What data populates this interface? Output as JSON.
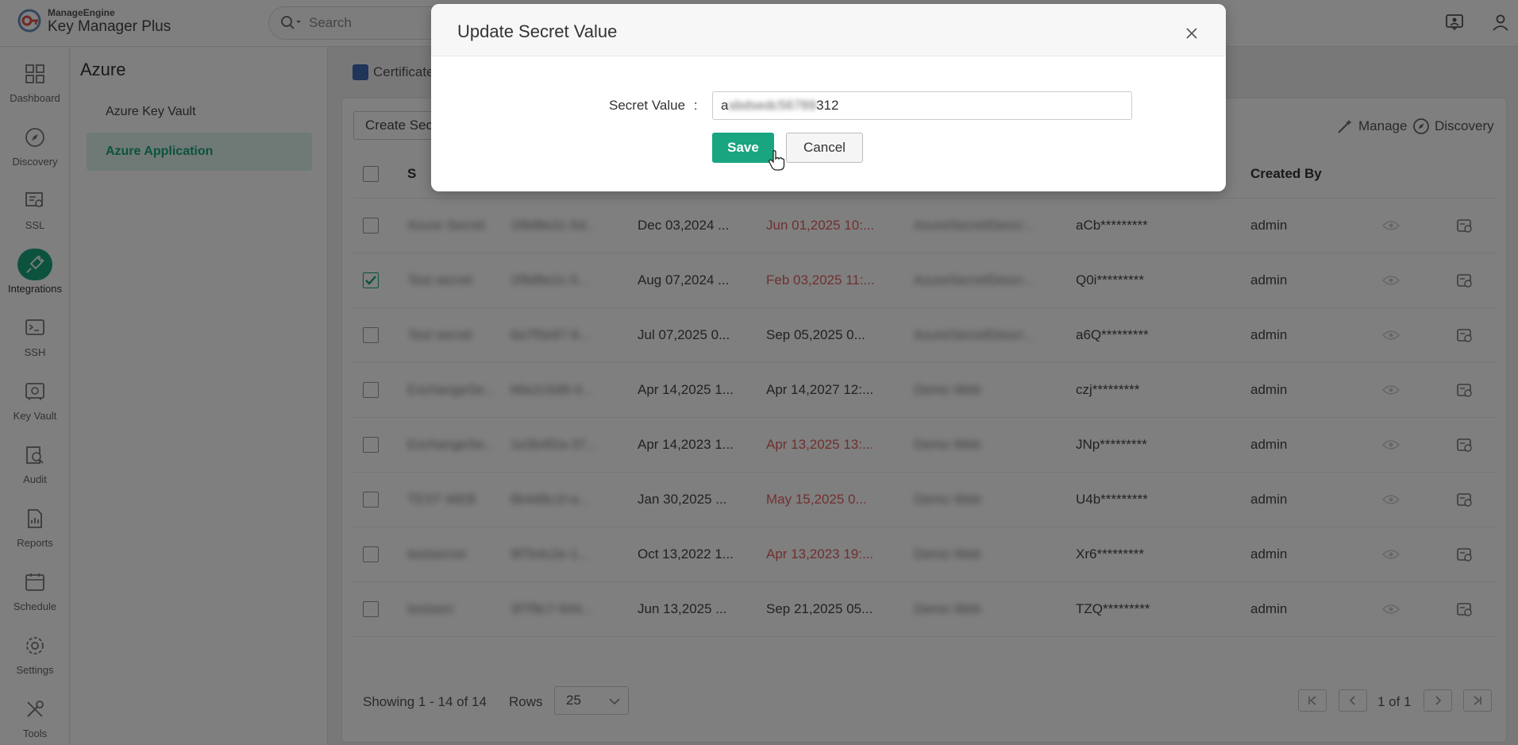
{
  "app": {
    "brand_small": "ManageEngine",
    "brand_name": "Key Manager Plus"
  },
  "search": {
    "label": "Search"
  },
  "nav": {
    "items": [
      {
        "label": "Dashboard",
        "icon": "grid-icon"
      },
      {
        "label": "Discovery",
        "icon": "compass-icon"
      },
      {
        "label": "SSL",
        "icon": "certificate-icon"
      },
      {
        "label": "Integrations",
        "icon": "plug-icon",
        "active": true
      },
      {
        "label": "SSH",
        "icon": "terminal-icon"
      },
      {
        "label": "Key Vault",
        "icon": "vault-icon"
      },
      {
        "label": "Audit",
        "icon": "audit-icon"
      },
      {
        "label": "Reports",
        "icon": "report-icon"
      },
      {
        "label": "Schedule",
        "icon": "calendar-icon"
      },
      {
        "label": "Settings",
        "icon": "gear-icon"
      },
      {
        "label": "Tools",
        "icon": "tools-icon"
      }
    ]
  },
  "submenu": {
    "title": "Azure",
    "items": [
      {
        "label": "Azure Key Vault"
      },
      {
        "label": "Azure Application",
        "active": true
      }
    ]
  },
  "main": {
    "tab_label": "Certificate",
    "create_label": "Create Secret",
    "manage_label": "Manage",
    "discovery_label": "Discovery",
    "header": {
      "col1_initial": "S",
      "created_by": "Created By"
    },
    "rows": [
      {
        "name": "Azure Secret",
        "id": "1f9d8e2c-5d...",
        "created": "Dec 03,2024 ...",
        "expiry": "Jun 01,2025 10:...",
        "expired": true,
        "app": "AzureSecretDescr...",
        "value": "aCb*********",
        "by": "admin",
        "checked": false
      },
      {
        "name": "Test secret",
        "id": "1f9d8e2c-5...",
        "created": "Aug 07,2024 ...",
        "expiry": "Feb 03,2025 11:...",
        "expired": true,
        "app": "AzureSecretDescr...",
        "value": "Q0i*********",
        "by": "admin",
        "checked": true
      },
      {
        "name": "Test secret",
        "id": "6a7f5e97-8...",
        "created": "Jul 07,2025 0...",
        "expiry": "Sep 05,2025 0...",
        "expired": false,
        "app": "AzureSecretDescr...",
        "value": "a6Q*********",
        "by": "admin",
        "checked": false
      },
      {
        "name": "ExchangeSe...",
        "id": "b6e2c5d8-4...",
        "created": "Apr 14,2025 1...",
        "expiry": "Apr 14,2027 12:...",
        "expired": false,
        "app": "Demo Web",
        "value": "czj*********",
        "by": "admin",
        "checked": false
      },
      {
        "name": "ExchangeSe...",
        "id": "1e3b4f2a-37...",
        "created": "Apr 14,2023 1...",
        "expiry": "Apr 13,2025 13:...",
        "expired": true,
        "app": "Demo Web",
        "value": "JNp*********",
        "by": "admin",
        "checked": false
      },
      {
        "name": "TEST WEB",
        "id": "8b4d9c1f-a...",
        "created": "Jan 30,2025 ...",
        "expiry": "May 15,2025 0...",
        "expired": true,
        "app": "Demo Web",
        "value": "U4b*********",
        "by": "admin",
        "checked": false
      },
      {
        "name": "testsecret",
        "id": "9f7b4c2e-1...",
        "created": "Oct 13,2022 1...",
        "expiry": "Apr 13,2023 19:...",
        "expired": true,
        "app": "Demo Web",
        "value": "Xr6*********",
        "by": "admin",
        "checked": false
      },
      {
        "name": "testsecr",
        "id": "3f7f9c7-644...",
        "created": "Jun 13,2025 ...",
        "expiry": "Sep 21,2025 05...",
        "expired": false,
        "app": "Demo Web",
        "value": "TZQ*********",
        "by": "admin",
        "checked": false
      }
    ],
    "footer": {
      "showing": "Showing 1 - 14 of 14",
      "rows_label": "Rows",
      "rows_value": "25",
      "page_text": "1 of 1"
    }
  },
  "modal": {
    "title": "Update Secret Value",
    "field_label": "Secret Value",
    "field_colon": ":",
    "value_prefix": "a",
    "value_masked": "sbdsedc56789",
    "value_suffix": "312",
    "save_label": "Save",
    "cancel_label": "Cancel"
  },
  "colors": {
    "accent": "#19a57f",
    "expired_text": "#e06060"
  }
}
